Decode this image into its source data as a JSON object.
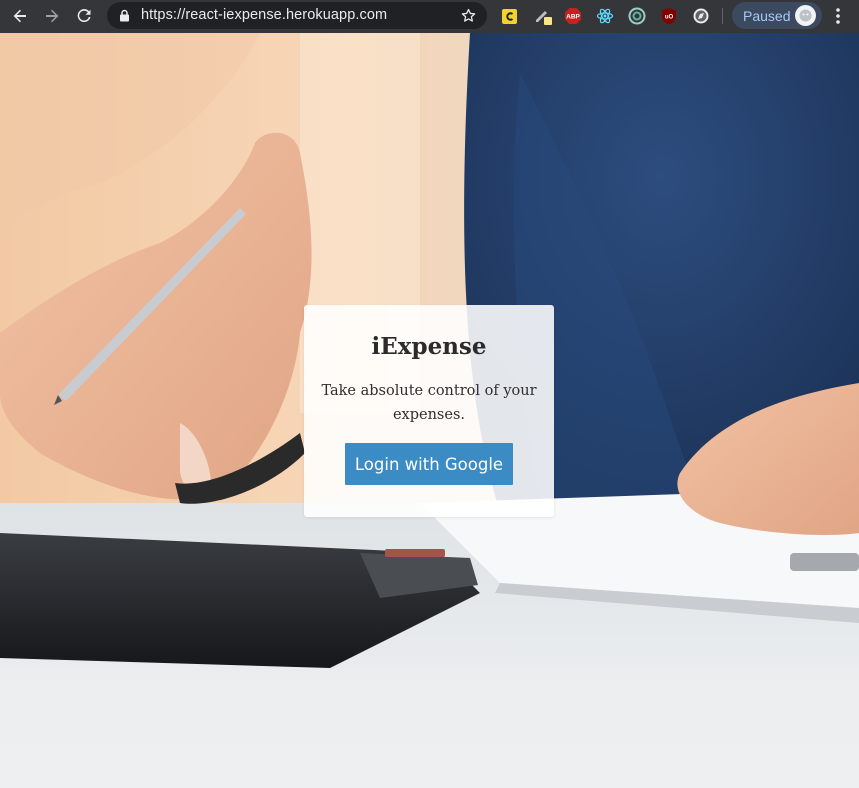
{
  "browser": {
    "url": "https://react-iexpense.herokuapp.com",
    "profile_status": "Paused",
    "icons": [
      "back-arrow-icon",
      "forward-arrow-icon",
      "reload-icon",
      "lock-icon",
      "star-icon",
      "ext-yellow-icon",
      "ext-pen-icon",
      "adblock-icon",
      "react-devtools-icon",
      "ext-circle-icon",
      "ublock-icon",
      "ext-compass-icon",
      "more-menu-icon"
    ]
  },
  "card": {
    "title": "iExpense",
    "tagline": "Take absolute control of your expenses.",
    "login_label": "Login with Google"
  },
  "colors": {
    "button": "#3b8bc4",
    "button_text": "#ffffff",
    "chrome": "#35363a"
  }
}
